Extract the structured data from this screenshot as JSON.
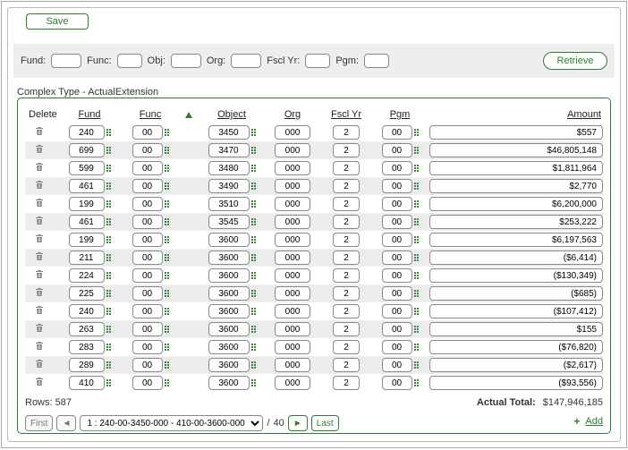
{
  "buttons": {
    "save": "Save",
    "retrieve": "Retrieve"
  },
  "filters": {
    "fund": {
      "label": "Fund:"
    },
    "func": {
      "label": "Func:"
    },
    "obj": {
      "label": "Obj:"
    },
    "org": {
      "label": "Org:"
    },
    "fsclyr": {
      "label": "Fscl Yr:"
    },
    "pgm": {
      "label": "Pgm:"
    }
  },
  "section_title": "Complex Type - ActualExtension",
  "columns": {
    "delete": "Delete",
    "fund": "Fund",
    "func": "Func",
    "object": "Object",
    "org": "Org",
    "fsclyr": "Fscl Yr",
    "pgm": "Pgm",
    "amount": "Amount"
  },
  "rows": [
    {
      "fund": "240",
      "func": "00",
      "object": "3450",
      "org": "000",
      "fsclyr": "2",
      "pgm": "00",
      "amount": "$557"
    },
    {
      "fund": "699",
      "func": "00",
      "object": "3470",
      "org": "000",
      "fsclyr": "2",
      "pgm": "00",
      "amount": "$46,805,148"
    },
    {
      "fund": "599",
      "func": "00",
      "object": "3480",
      "org": "000",
      "fsclyr": "2",
      "pgm": "00",
      "amount": "$1,811,964"
    },
    {
      "fund": "461",
      "func": "00",
      "object": "3490",
      "org": "000",
      "fsclyr": "2",
      "pgm": "00",
      "amount": "$2,770"
    },
    {
      "fund": "199",
      "func": "00",
      "object": "3510",
      "org": "000",
      "fsclyr": "2",
      "pgm": "00",
      "amount": "$6,200,000"
    },
    {
      "fund": "461",
      "func": "00",
      "object": "3545",
      "org": "000",
      "fsclyr": "2",
      "pgm": "00",
      "amount": "$253,222"
    },
    {
      "fund": "199",
      "func": "00",
      "object": "3600",
      "org": "000",
      "fsclyr": "2",
      "pgm": "00",
      "amount": "$6,197,563"
    },
    {
      "fund": "211",
      "func": "00",
      "object": "3600",
      "org": "000",
      "fsclyr": "2",
      "pgm": "00",
      "amount": "($6,414)"
    },
    {
      "fund": "224",
      "func": "00",
      "object": "3600",
      "org": "000",
      "fsclyr": "2",
      "pgm": "00",
      "amount": "($130,349)"
    },
    {
      "fund": "225",
      "func": "00",
      "object": "3600",
      "org": "000",
      "fsclyr": "2",
      "pgm": "00",
      "amount": "($685)"
    },
    {
      "fund": "240",
      "func": "00",
      "object": "3600",
      "org": "000",
      "fsclyr": "2",
      "pgm": "00",
      "amount": "($107,412)"
    },
    {
      "fund": "263",
      "func": "00",
      "object": "3600",
      "org": "000",
      "fsclyr": "2",
      "pgm": "00",
      "amount": "$155"
    },
    {
      "fund": "283",
      "func": "00",
      "object": "3600",
      "org": "000",
      "fsclyr": "2",
      "pgm": "00",
      "amount": "($76,820)"
    },
    {
      "fund": "289",
      "func": "00",
      "object": "3600",
      "org": "000",
      "fsclyr": "2",
      "pgm": "00",
      "amount": "($2,617)"
    },
    {
      "fund": "410",
      "func": "00",
      "object": "3600",
      "org": "000",
      "fsclyr": "2",
      "pgm": "00",
      "amount": "($93,556)"
    }
  ],
  "footer": {
    "rows_label": "Rows:",
    "rows_count": "587",
    "actual_total_label": "Actual Total:",
    "actual_total_value": "$147,946,185"
  },
  "pager": {
    "first": "First",
    "prev": "◄",
    "next": "►",
    "last": "Last",
    "range": "1 : 240-00-3450-000 - 410-00-3600-000",
    "sep": "/",
    "total_pages": "40",
    "add": "Add"
  }
}
